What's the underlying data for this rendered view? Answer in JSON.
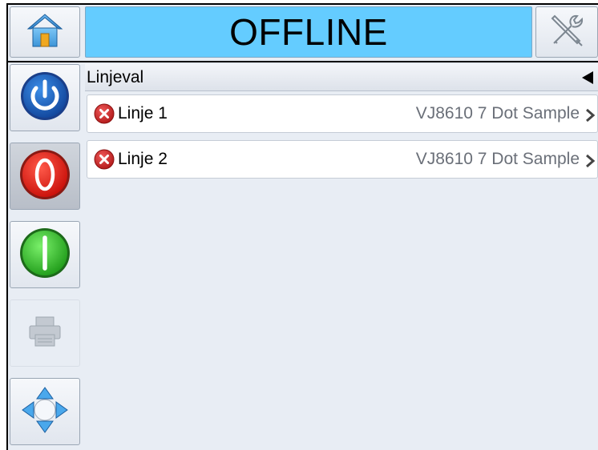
{
  "topbar": {
    "status": "OFFLINE",
    "status_color": "#64ccff"
  },
  "icons": {
    "home": "home-icon",
    "tools": "tools-icon",
    "power": "power-icon",
    "stop": "stop-icon",
    "start": "start-icon",
    "print": "print-icon",
    "navigate": "navigation-arrows-icon",
    "error": "error-icon",
    "chevron": "chevron-right-icon",
    "back": "back-triangle-icon"
  },
  "panel": {
    "title": "Linjeval",
    "lines": [
      {
        "name": "Linje 1",
        "job": "VJ8610 7 Dot Sample",
        "status": "error"
      },
      {
        "name": "Linje 2",
        "job": "VJ8610 7 Dot Sample",
        "status": "error"
      }
    ]
  }
}
